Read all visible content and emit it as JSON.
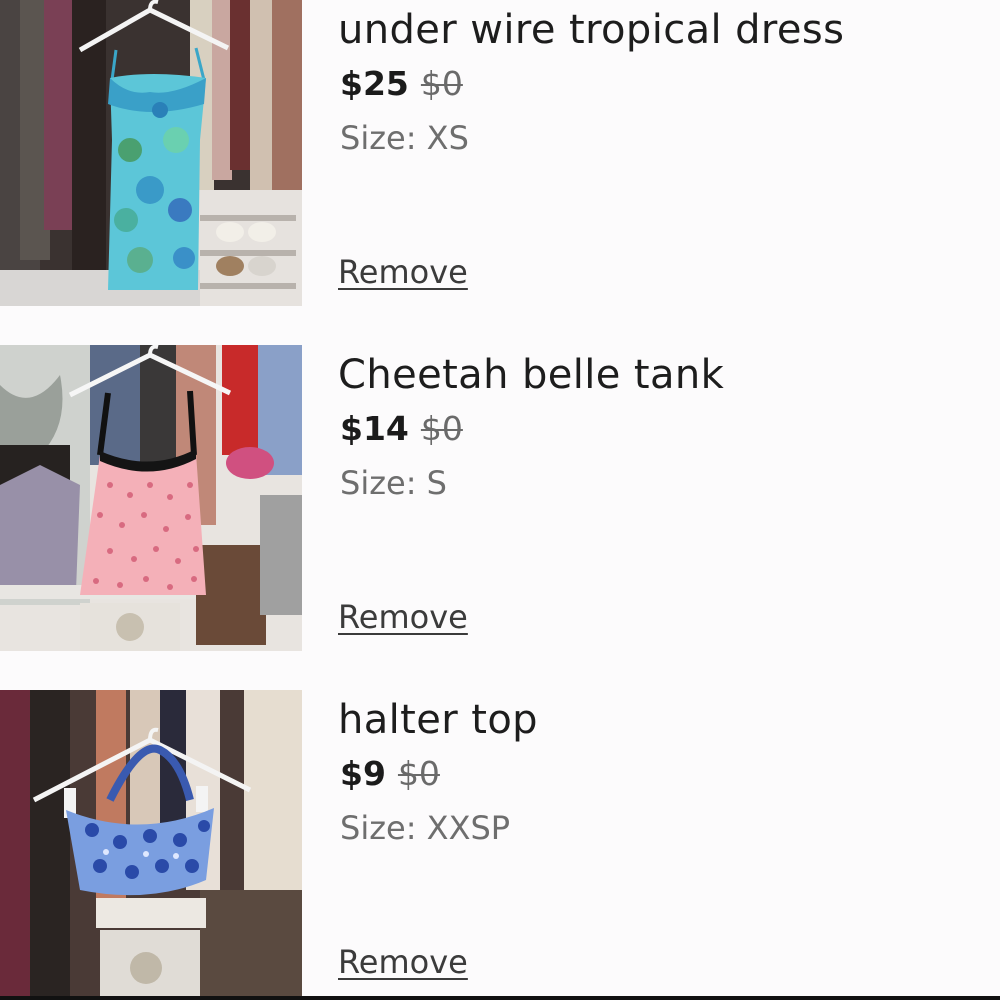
{
  "cart": {
    "items": [
      {
        "title": "under wire tropical dress",
        "price": "$25",
        "original_price": "$0",
        "size": "Size: XS",
        "remove_label": "Remove"
      },
      {
        "title": "Cheetah belle tank",
        "price": "$14",
        "original_price": "$0",
        "size": "Size: S",
        "remove_label": "Remove"
      },
      {
        "title": "halter top",
        "price": "$9",
        "original_price": "$0",
        "size": "Size: XXSP",
        "remove_label": "Remove"
      }
    ]
  }
}
